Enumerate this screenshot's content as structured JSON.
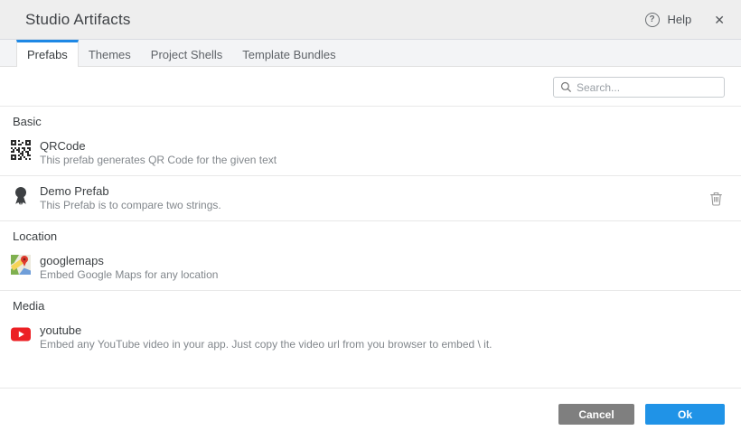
{
  "header": {
    "title": "Studio Artifacts",
    "help_label": "Help"
  },
  "icons": {
    "help_glyph": "?",
    "close_glyph": "✕"
  },
  "tabs": [
    {
      "label": "Prefabs",
      "active": true
    },
    {
      "label": "Themes",
      "active": false
    },
    {
      "label": "Project Shells",
      "active": false
    },
    {
      "label": "Template Bundles",
      "active": false
    }
  ],
  "search": {
    "placeholder": "Search...",
    "value": ""
  },
  "sections": [
    {
      "label": "Basic",
      "items": [
        {
          "icon": "qrcode-icon",
          "title": "QRCode",
          "description": "This prefab generates QR Code for the given text",
          "deletable": false
        },
        {
          "icon": "medal-icon",
          "title": "Demo Prefab",
          "description": "This Prefab is to compare two strings.",
          "deletable": true
        }
      ]
    },
    {
      "label": "Location",
      "items": [
        {
          "icon": "googlemaps-icon",
          "title": "googlemaps",
          "description": "Embed Google Maps for any location",
          "deletable": false
        }
      ]
    },
    {
      "label": "Media",
      "items": [
        {
          "icon": "youtube-icon",
          "title": "youtube",
          "description": "Embed any YouTube video in your app. Just copy the video url from you browser to embed \\ it.",
          "deletable": false
        }
      ]
    }
  ],
  "footer": {
    "cancel_label": "Cancel",
    "ok_label": "Ok"
  },
  "colors": {
    "accent": "#1e88e5",
    "ok_button": "#2093e7",
    "cancel_button": "#7f7f7f"
  }
}
